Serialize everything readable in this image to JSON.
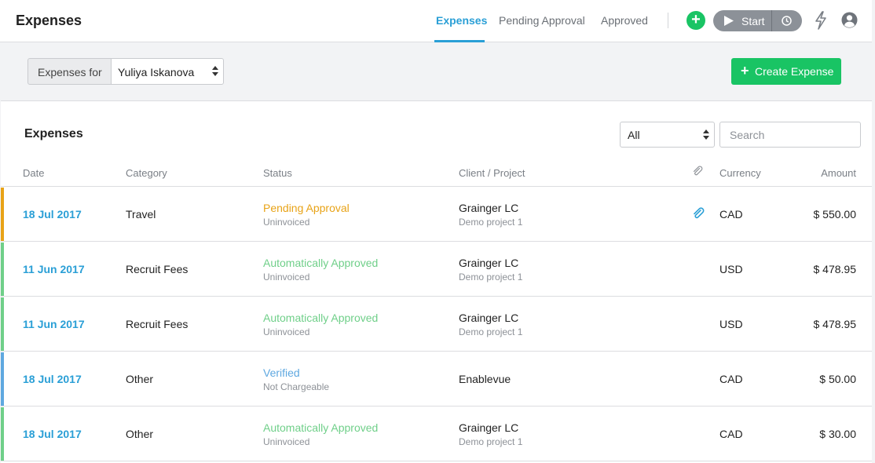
{
  "app": {
    "title": "Expenses"
  },
  "nav": {
    "tabs": [
      {
        "label": "Expenses",
        "active": true
      },
      {
        "label": "Pending Approval",
        "active": false
      },
      {
        "label": "Approved",
        "active": false
      }
    ],
    "start_label": "Start"
  },
  "filter": {
    "addon_label": "Expenses for",
    "selected_user": "Yuliya Iskanova"
  },
  "create_button_label": "Create Expense",
  "panel": {
    "title": "Expenses",
    "status_filter": "All",
    "search_placeholder": "Search"
  },
  "table": {
    "columns": {
      "date": "Date",
      "category": "Category",
      "status": "Status",
      "client_project": "Client / Project",
      "currency": "Currency",
      "amount": "Amount"
    },
    "rows": [
      {
        "date": "18 Jul 2017",
        "category": "Travel",
        "status": "Pending Approval",
        "status_sub": "Uninvoiced",
        "client": "Grainger LC",
        "project": "Demo project 1",
        "has_attachment": true,
        "currency": "CAD",
        "amount": "$ 550.00",
        "color": "#e8a317"
      },
      {
        "date": "11 Jun 2017",
        "category": "Recruit Fees",
        "status": "Automatically Approved",
        "status_sub": "Uninvoiced",
        "client": "Grainger LC",
        "project": "Demo project 1",
        "has_attachment": false,
        "currency": "USD",
        "amount": "$ 478.95",
        "color": "#6fcf89"
      },
      {
        "date": "11 Jun 2017",
        "category": "Recruit Fees",
        "status": "Automatically Approved",
        "status_sub": "Uninvoiced",
        "client": "Grainger LC",
        "project": "Demo project 1",
        "has_attachment": false,
        "currency": "USD",
        "amount": "$ 478.95",
        "color": "#6fcf89"
      },
      {
        "date": "18 Jul 2017",
        "category": "Other",
        "status": "Verified",
        "status_sub": "Not Chargeable",
        "client": "Enablevue",
        "project": "",
        "has_attachment": false,
        "currency": "CAD",
        "amount": "$ 50.00",
        "color": "#5fa8e0"
      },
      {
        "date": "18 Jul 2017",
        "category": "Other",
        "status": "Automatically Approved",
        "status_sub": "Uninvoiced",
        "client": "Grainger LC",
        "project": "Demo project 1",
        "has_attachment": false,
        "currency": "CAD",
        "amount": "$ 30.00",
        "color": "#6fcf89"
      }
    ]
  },
  "colors": {
    "accent": "#2a9fd6",
    "success": "#19c464",
    "pending": "#e8a317",
    "approved": "#6fcf89",
    "verified": "#5fa8e0"
  }
}
